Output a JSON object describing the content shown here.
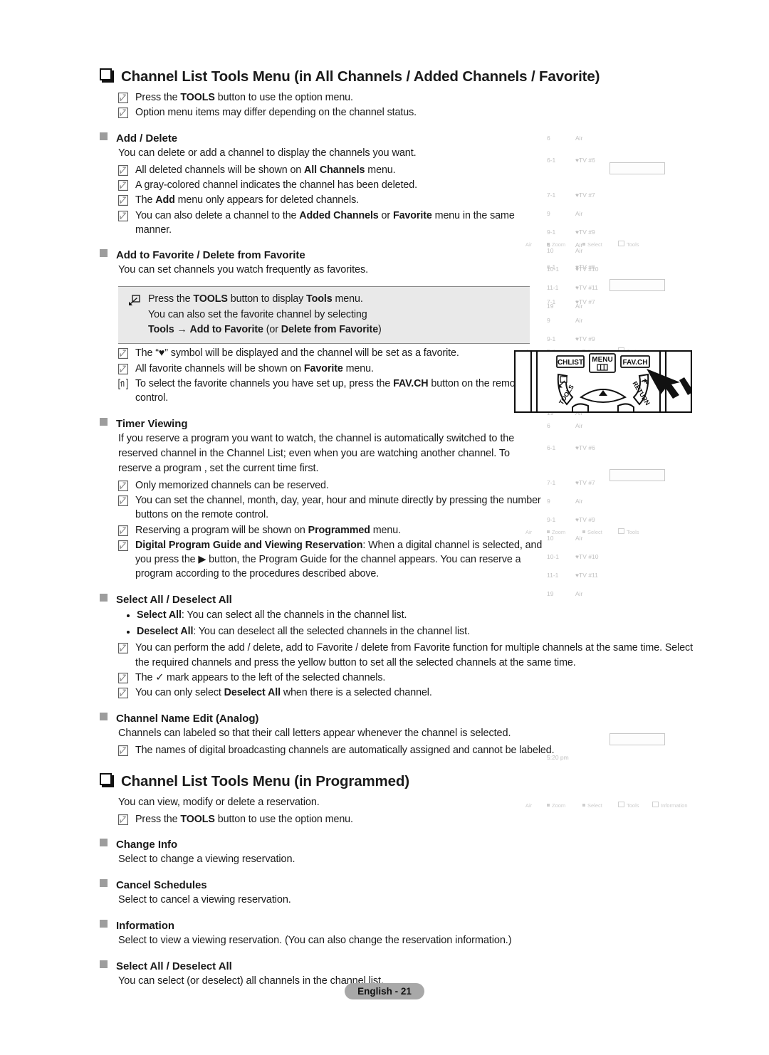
{
  "document": {
    "footer_label": "English - 21"
  },
  "section1": {
    "heading": "Channel List Tools Menu (in All Channels / Added Channels / Favorite)",
    "notes": [
      "Press the TOOLS button to use the option menu.",
      "Option menu items may differ depending on the channel status."
    ],
    "add_delete": {
      "heading": "Add / Delete",
      "intro": "You can delete or add a channel to display the channels you want.",
      "notes": [
        "All deleted channels will be shown on All Channels menu.",
        "A gray-colored channel indicates the channel has been deleted.",
        "The Add menu only appears for deleted channels.",
        "You can also delete a channel to the Added Channels or Favorite menu in the same manner."
      ]
    },
    "favorite": {
      "heading": "Add to Favorite / Delete from Favorite",
      "intro": "You can set channels you watch frequently as favorites.",
      "tip_lines": [
        "Press the TOOLS button to display Tools menu.",
        "You can also set the favorite channel by selecting",
        "Tools → Add to Favorite (or Delete from Favorite)"
      ],
      "notes": [
        "The “♥” symbol will be displayed and the channel will be set as a favorite.",
        "All favorite channels will be shown on Favorite menu.",
        "To select the favorite channels you have set up, press the FAV.CH button on the remote control."
      ]
    },
    "timer_viewing": {
      "heading": "Timer Viewing",
      "intro_lines": [
        "If you reserve a program you want to watch, the channel is automatically switched to the",
        "reserved channel in the Channel List; even when you are watching another channel.",
        "To reserve a program , set the current time first."
      ],
      "notes": [
        "Only memorized channels can be reserved.",
        "You can set the channel, month, day, year, hour and minute directly by pressing the number buttons on the remote control.",
        "Reserving a program will be shown on Programmed menu.",
        "Digital Program Guide and Viewing Reservation: When a digital channel is selected, and you press the ▶ button, the Program Guide for the channel appears. You can reserve a program according to the procedures described above."
      ]
    },
    "select_all": {
      "heading": "Select All / Deselect All",
      "bullets": [
        "Select All: You can select all the channels in the channel list.",
        "Deselect All: You can deselect all the selected channels in the channel list."
      ],
      "notes": [
        "You can perform the add / delete, add to Favorite / delete from Favorite function for multiple channels at the same time. Select the required channels and press the yellow button to set all the selected channels at the same time.",
        "The ✓ mark appears to the left of the selected channels.",
        "You can only select Deselect All when there is a selected channel."
      ]
    },
    "channel_name_edit": {
      "heading": "Channel Name Edit (Analog)",
      "intro": "Channels can labeled so that their call letters appear whenever the channel is selected.",
      "notes": [
        "The names of digital broadcasting channels are automatically assigned and cannot be labeled."
      ]
    }
  },
  "section2": {
    "heading": "Channel List Tools Menu (in Programmed)",
    "intro": "You can view, modify or delete a reservation.",
    "notes": [
      "Press the TOOLS button to use the option menu."
    ],
    "items": [
      {
        "heading": "Change Info",
        "text": "Select to change a viewing reservation."
      },
      {
        "heading": "Cancel Schedules",
        "text": "Select to cancel a viewing reservation."
      },
      {
        "heading": "Information",
        "text": "Select to view a viewing reservation. (You can also change the reservation information.)"
      },
      {
        "heading": "Select All / Deselect All",
        "text": "You can select (or deselect) all channels in the channel list."
      }
    ]
  },
  "screenshots": {
    "channel_rows": [
      {
        "num": "6",
        "name": "Air",
        "fav": false
      },
      {
        "num": "6-1",
        "name": "TV #6",
        "fav": true
      },
      {
        "num": "7-1",
        "name": "TV #7",
        "fav": true
      },
      {
        "num": "9",
        "name": "Air",
        "fav": false
      },
      {
        "num": "9-1",
        "name": "TV #9",
        "fav": true
      },
      {
        "num": "10",
        "name": "Air",
        "fav": false
      },
      {
        "num": "10-1",
        "name": "TV #10",
        "fav": true
      },
      {
        "num": "11-1",
        "name": "TV #11",
        "fav": true
      },
      {
        "num": "19",
        "name": "Air",
        "fav": false
      }
    ],
    "toolbar": {
      "source": "Air",
      "zoom": "Zoom",
      "select": "Select",
      "tools": "Tools",
      "information": "Information"
    },
    "programmed_time": "5:20 pm"
  },
  "remote": {
    "buttons": {
      "ch_list": "CH LIST",
      "menu": "MENU",
      "fav_ch": "FAV.CH",
      "tools": "TOOLS",
      "return": "RETURN"
    }
  }
}
